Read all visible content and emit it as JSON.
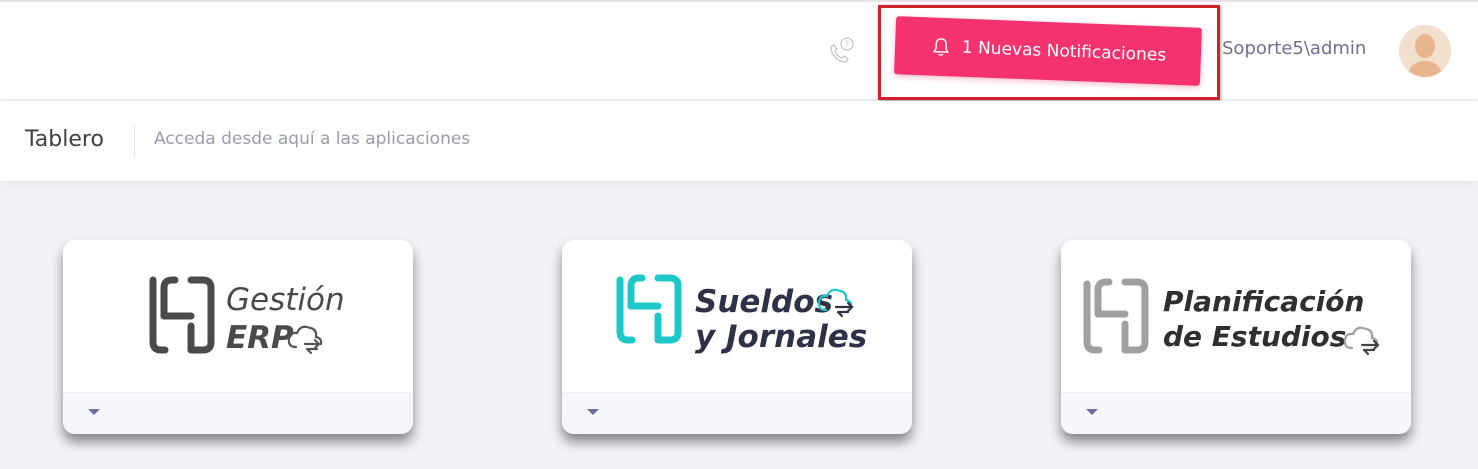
{
  "header": {
    "notification_label": "1 Nuevas Notificaciones",
    "user_name": "Soporte5\\admin",
    "icons": {
      "phone": "phone-help-icon",
      "bell": "bell-icon",
      "avatar": "user-avatar"
    },
    "accent_color": "#f4336e"
  },
  "subheader": {
    "title": "Tablero",
    "description": "Acceda desde aquí a las aplicaciones"
  },
  "apps": [
    {
      "line1": "Gestión",
      "line2": "ERP",
      "brand_color": "#4a4a4a"
    },
    {
      "line1": "Sueldos",
      "line2": "y Jornales",
      "brand_color": "#1ec8c8"
    },
    {
      "line1": "Planificación",
      "line2": "de Estudios",
      "brand_color": "#9e9e9e"
    }
  ]
}
